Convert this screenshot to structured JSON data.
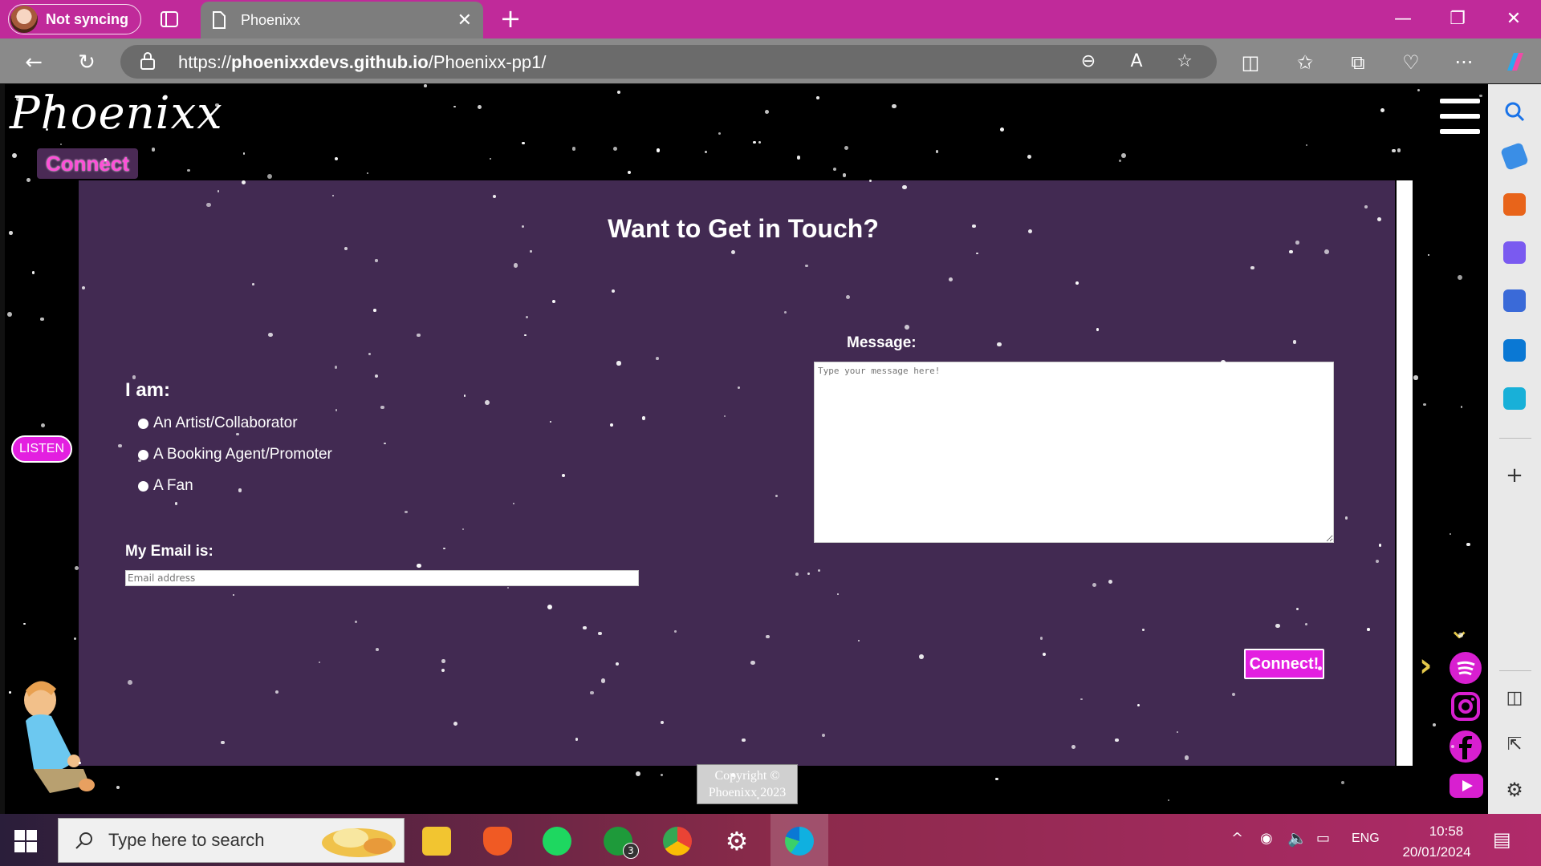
{
  "browser": {
    "profile_label": "Not syncing",
    "tab_title": "Phoenixx",
    "url_prefix": "https://",
    "url_domain": "phoenixxdevs.github.io",
    "url_path": "/Phoenixx-pp1/"
  },
  "site": {
    "logo_text": "Phoenixx",
    "nav_tag": "Connect",
    "listen_label": "LISTEN",
    "heading": "Want to Get in Touch?",
    "iam_label": "I am:",
    "options": [
      "An Artist/Collaborator",
      "A Booking Agent/Promoter",
      "A Fan"
    ],
    "email_label": "My Email is:",
    "email_placeholder": "Email address",
    "message_label": "Message:",
    "message_placeholder": "Type your message here!",
    "submit_label": "Connect!",
    "copyright_line1": "Copyright ©",
    "copyright_line2": "Phoenixx 2023"
  },
  "taskbar": {
    "search_placeholder": "Type here to search",
    "language": "ENG",
    "time": "10:58",
    "date": "20/01/2024",
    "xbox_badge": "3"
  },
  "colors": {
    "accent": "#e31fe0",
    "panel": "#422a52",
    "titlebar": "#c02a9a"
  }
}
